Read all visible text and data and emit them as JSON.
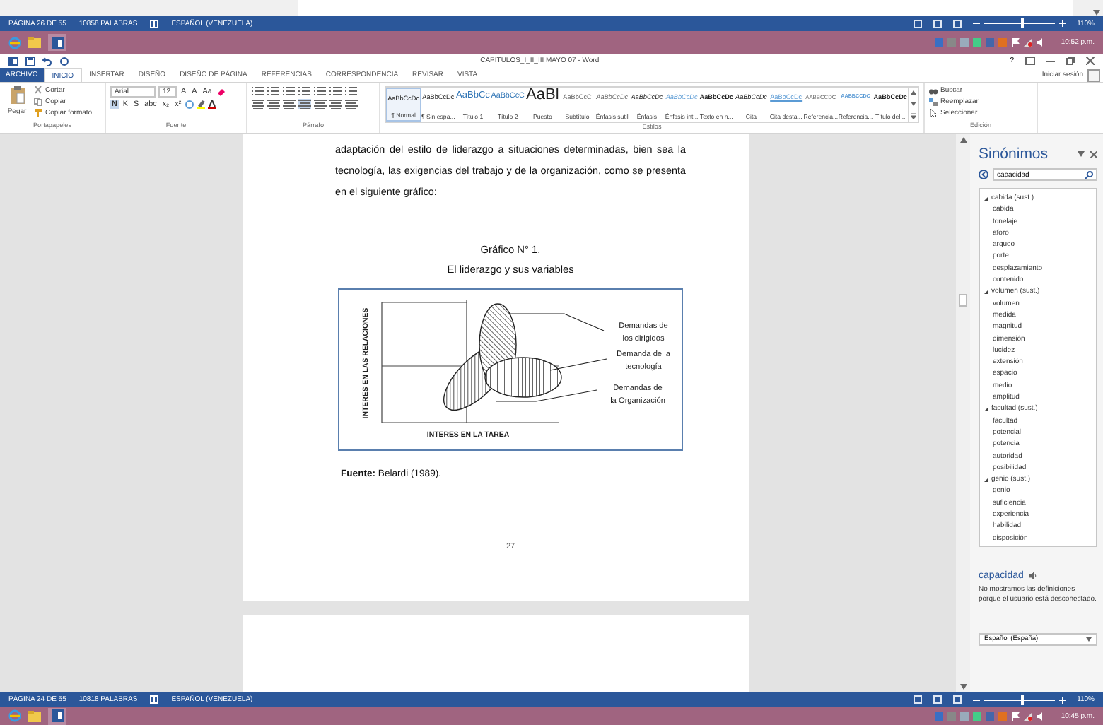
{
  "upper_status_bar": {
    "page": "PÁGINA 26 DE 55",
    "words": "10858 PALABRAS",
    "language": "ESPAÑOL (VENEZUELA)",
    "zoom": "110%",
    "zoom_slider": {
      "level": 0.55
    }
  },
  "upper_taskbar": {
    "time": "10:52 p.m."
  },
  "window": {
    "title": "CAPITULOS_I_II_III MAYO 07 - Word",
    "help": "?",
    "sign_in": "Iniciar sesión"
  },
  "ribbon_tabs": [
    {
      "label": "ARCHIVO",
      "kind": "file",
      "selected": false
    },
    {
      "label": "INICIO",
      "kind": "tab",
      "selected": true
    },
    {
      "label": "INSERTAR",
      "kind": "tab",
      "selected": false
    },
    {
      "label": "DISEÑO",
      "kind": "tab",
      "selected": false
    },
    {
      "label": "DISEÑO DE PÁGINA",
      "kind": "tab",
      "selected": false
    },
    {
      "label": "REFERENCIAS",
      "kind": "tab",
      "selected": false
    },
    {
      "label": "CORRESPONDENCIA",
      "kind": "tab",
      "selected": false
    },
    {
      "label": "REVISAR",
      "kind": "tab",
      "selected": false
    },
    {
      "label": "VISTA",
      "kind": "tab",
      "selected": false
    }
  ],
  "ribbon": {
    "clipboard": {
      "paste": "Pegar",
      "cut": "Cortar",
      "copy": "Copiar",
      "format_painter": "Copiar formato",
      "label": "Portapapeles"
    },
    "font": {
      "name": "Arial",
      "size": "12",
      "size_buttons": [
        "A",
        "A",
        "Aa"
      ],
      "format_buttons": [
        "N",
        "K",
        "S",
        "abc",
        "x₂",
        "x²"
      ],
      "label": "Fuente"
    },
    "paragraph": {
      "label": "Párrafo"
    },
    "styles": {
      "label": "Estilos",
      "items": [
        {
          "preview": "AaBbCcDc",
          "name": "¶ Normal",
          "kind": "plain",
          "selected": true
        },
        {
          "preview": "AaBbCcDc",
          "name": "¶ Sin espa...",
          "kind": "plain",
          "selected": false
        },
        {
          "preview": "AaBbCc",
          "name": "Título 1",
          "kind": "heading",
          "selected": false
        },
        {
          "preview": "AaBbCcC",
          "name": "Título 2",
          "kind": "heading2",
          "selected": false
        },
        {
          "preview": "AaBl",
          "name": "Puesto",
          "kind": "title",
          "selected": false
        },
        {
          "preview": "AaBbCcC",
          "name": "Subtítulo",
          "kind": "subtle",
          "selected": false
        },
        {
          "preview": "AaBbCcDc",
          "name": "Énfasis sutil",
          "kind": "subtle-italic",
          "selected": false
        },
        {
          "preview": "AaBbCcDc",
          "name": "Énfasis",
          "kind": "italic",
          "selected": false
        },
        {
          "preview": "AaBbCcDc",
          "name": "Énfasis int...",
          "kind": "accent-italic",
          "selected": false
        },
        {
          "preview": "AaBbCcDc",
          "name": "Texto en n...",
          "kind": "bold",
          "selected": false
        },
        {
          "preview": "AaBbCcDc",
          "name": "Cita",
          "kind": "italic",
          "selected": false
        },
        {
          "preview": "AaBbCcDc",
          "name": "Cita desta...",
          "kind": "accent-underline",
          "selected": false
        },
        {
          "preview": "AABBCCDC",
          "name": "Referencia...",
          "kind": "caps",
          "selected": false
        },
        {
          "preview": "AABBCCDC",
          "name": "Referencia...",
          "kind": "accent-caps",
          "selected": false
        },
        {
          "preview": "AaBbCcDc",
          "name": "Título del...",
          "kind": "bold",
          "selected": false
        }
      ]
    },
    "editing": {
      "find": "Buscar",
      "replace": "Reemplazar",
      "select": "Seleccionar",
      "label": "Edición"
    }
  },
  "document": {
    "paragraph": "adaptación del estilo de liderazgo a situaciones determinadas, bien sea la tecnología, las exigencias del trabajo y de la organización, como se presenta en el siguiente gráfico:",
    "figure_title": "Gráfico N° 1.",
    "figure_subtitle": "El liderazgo y sus variables",
    "figure": {
      "y_axis_label": "INTERES EN LAS RELACIONES",
      "x_axis_label": "INTERES EN LA TAREA",
      "callouts": [
        {
          "kind": "vertical",
          "lines": [
            "Demandas de",
            "los dirigidos"
          ]
        },
        {
          "kind": "horizontal",
          "lines": [
            "Demanda de la",
            "tecnología"
          ]
        },
        {
          "kind": "diagonal",
          "lines": [
            "Demandas de",
            "la Organización"
          ]
        }
      ]
    },
    "source": "**Fuente:** Belardi (1989).",
    "page_number": "27"
  },
  "thesaurus_pane": {
    "title": "Sinónimos",
    "search": "capacidad",
    "groups": [
      {
        "label": "cabida (sust.)",
        "expanded": true,
        "children": [
          "cabida",
          "tonelaje",
          "aforo",
          "arqueo",
          "porte",
          "desplazamiento",
          "contenido"
        ]
      },
      {
        "label": "volumen (sust.)",
        "expanded": true,
        "children": [
          "volumen",
          "medida",
          "magnitud",
          "dimensión",
          "lucidez",
          "extensión",
          "espacio",
          "medio",
          "amplitud"
        ]
      },
      {
        "label": "facultad (sust.)",
        "expanded": true,
        "children": [
          "facultad",
          "potencial",
          "potencia",
          "autoridad",
          "posibilidad"
        ]
      },
      {
        "label": "genio (sust.)",
        "expanded": true,
        "children": [
          "genio",
          "suficiencia",
          "experiencia",
          "habilidad",
          "disposición"
        ]
      }
    ],
    "word": "capacidad",
    "message": "No mostramos las definiciones porque el usuario está desconectado.",
    "language": "Español (España)"
  },
  "lower_status_bar": {
    "page": "PÁGINA 24 DE 55",
    "words": "10818 PALABRAS",
    "language": "ESPAÑOL (VENEZUELA)",
    "zoom": "110%",
    "zoom_slider": {
      "level": 0.55
    }
  },
  "lower_taskbar": {
    "time": "10:45 p.m."
  }
}
